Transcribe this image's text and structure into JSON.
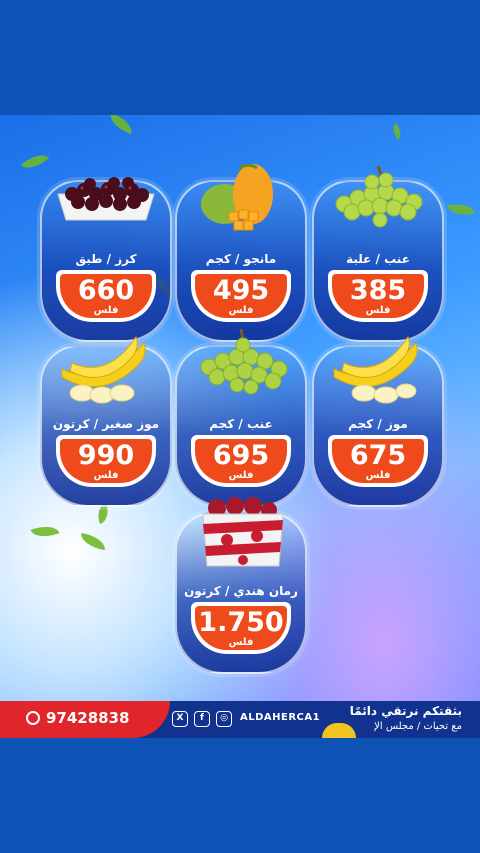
{
  "products": [
    {
      "name": "كرز / طبق",
      "price": "660",
      "unit": "فلس",
      "icon": "cherries-icon"
    },
    {
      "name": "مانجو / كجم",
      "price": "495",
      "unit": "فلس",
      "icon": "mango-icon"
    },
    {
      "name": "عنب / علبة",
      "price": "385",
      "unit": "فلس",
      "icon": "grapes-icon"
    },
    {
      "name": "موز صغير / كرتون",
      "price": "990",
      "unit": "فلس",
      "icon": "banana-icon"
    },
    {
      "name": "عنب / كجم",
      "price": "695",
      "unit": "فلس",
      "icon": "grapes-icon"
    },
    {
      "name": "موز / كجم",
      "price": "675",
      "unit": "فلس",
      "icon": "banana-icon"
    },
    {
      "name": "رمان هندي / كرتون",
      "price": "1.750",
      "unit": "فلس",
      "icon": "pomegranate-box-icon"
    }
  ],
  "footer": {
    "phone": "97428838",
    "handle": "ALDAHERCA1",
    "slogan": "بثقتكم نرتقي دائمًا",
    "subslogan": "مع تحيات / مجلس الإ"
  },
  "colors": {
    "price_badge": "#ef4a1b",
    "footer_blue": "#12328f",
    "footer_red": "#e0252b",
    "background": "#0f52b5"
  }
}
